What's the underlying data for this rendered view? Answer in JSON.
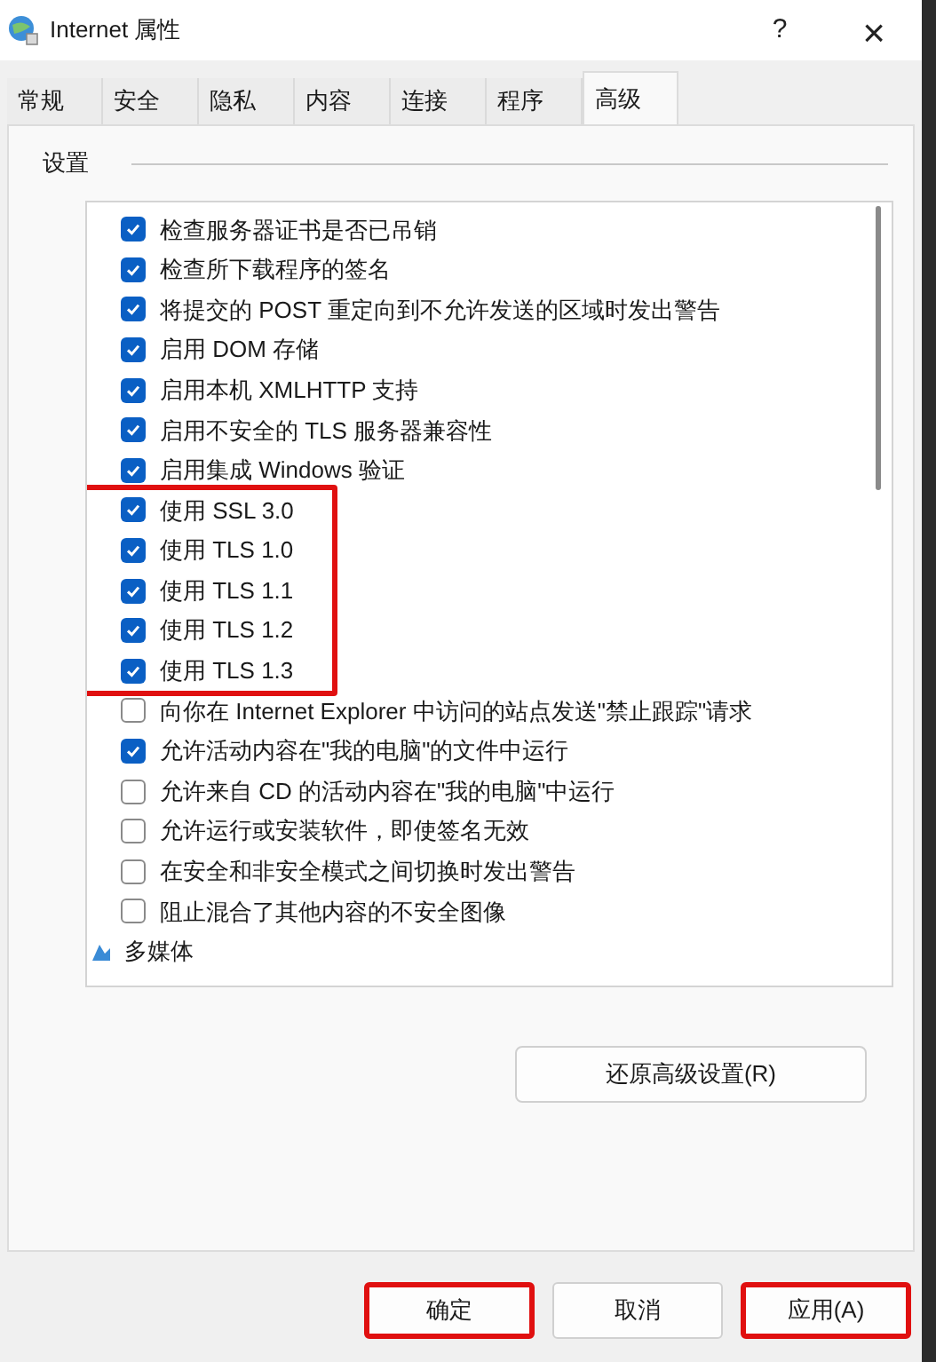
{
  "window": {
    "title": "Internet 属性",
    "help": "?",
    "close": "×"
  },
  "tabs": [
    {
      "label": "常规",
      "selected": false
    },
    {
      "label": "安全",
      "selected": false
    },
    {
      "label": "隐私",
      "selected": false
    },
    {
      "label": "内容",
      "selected": false
    },
    {
      "label": "连接",
      "selected": false
    },
    {
      "label": "程序",
      "selected": false
    },
    {
      "label": "高级",
      "selected": true
    }
  ],
  "settings_label": "设置",
  "settings": [
    {
      "kind": "checkbox",
      "label": "检查服务器证书是否已吊销",
      "checked": true,
      "highlighted": false
    },
    {
      "kind": "checkbox",
      "label": "检查所下载程序的签名",
      "checked": true,
      "highlighted": false
    },
    {
      "kind": "checkbox",
      "label": "将提交的 POST 重定向到不允许发送的区域时发出警告",
      "checked": true,
      "highlighted": false
    },
    {
      "kind": "checkbox",
      "label": "启用 DOM 存储",
      "checked": true,
      "highlighted": false
    },
    {
      "kind": "checkbox",
      "label": "启用本机 XMLHTTP 支持",
      "checked": true,
      "highlighted": false
    },
    {
      "kind": "checkbox",
      "label": "启用不安全的 TLS 服务器兼容性",
      "checked": true,
      "highlighted": false
    },
    {
      "kind": "checkbox",
      "label": "启用集成 Windows 验证",
      "checked": true,
      "highlighted": false
    },
    {
      "kind": "checkbox",
      "label": "使用 SSL 3.0",
      "checked": true,
      "highlighted": true
    },
    {
      "kind": "checkbox",
      "label": "使用 TLS 1.0",
      "checked": true,
      "highlighted": true
    },
    {
      "kind": "checkbox",
      "label": "使用 TLS 1.1",
      "checked": true,
      "highlighted": true
    },
    {
      "kind": "checkbox",
      "label": "使用 TLS 1.2",
      "checked": true,
      "highlighted": true
    },
    {
      "kind": "checkbox",
      "label": "使用 TLS 1.3",
      "checked": true,
      "highlighted": true
    },
    {
      "kind": "checkbox",
      "label": "向你在 Internet Explorer 中访问的站点发送\"禁止跟踪\"请求",
      "checked": false,
      "highlighted": false
    },
    {
      "kind": "checkbox",
      "label": "允许活动内容在\"我的电脑\"的文件中运行",
      "checked": true,
      "highlighted": false
    },
    {
      "kind": "checkbox",
      "label": "允许来自 CD 的活动内容在\"我的电脑\"中运行",
      "checked": false,
      "highlighted": false
    },
    {
      "kind": "checkbox",
      "label": "允许运行或安装软件，即使签名无效",
      "checked": false,
      "highlighted": false
    },
    {
      "kind": "checkbox",
      "label": "在安全和非安全模式之间切换时发出警告",
      "checked": false,
      "highlighted": false
    },
    {
      "kind": "checkbox",
      "label": "阻止混合了其他内容的不安全图像",
      "checked": false,
      "highlighted": false
    },
    {
      "kind": "category",
      "label": "多媒体"
    }
  ],
  "restore_button": "还原高级设置(R)",
  "buttons": [
    {
      "label": "确定",
      "highlighted": true
    },
    {
      "label": "取消",
      "highlighted": false
    },
    {
      "label": "应用(A)",
      "highlighted": true
    }
  ]
}
